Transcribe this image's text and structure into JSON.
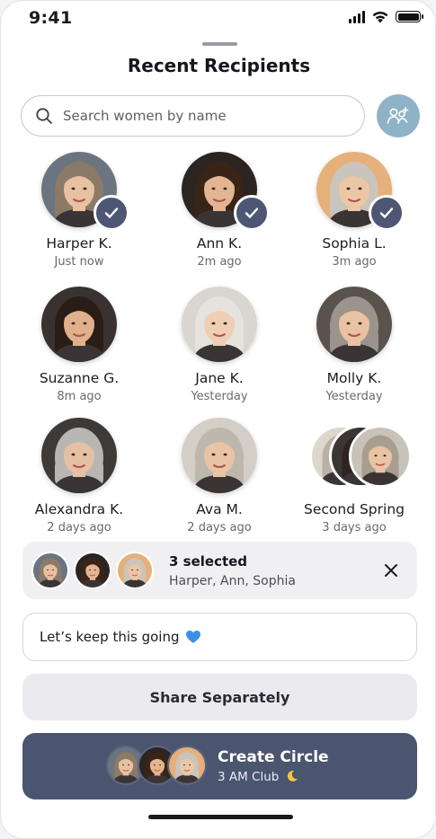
{
  "status_bar": {
    "time": "9:41"
  },
  "sheet": {
    "title": "Recent Recipients"
  },
  "search": {
    "placeholder": "Search women by name",
    "value": ""
  },
  "recipients": [
    {
      "name": "Harper K.",
      "time": "Just now",
      "selected": true,
      "hair": "#8c7a68",
      "skin": "#e7c1a1",
      "bg": "#6b7580"
    },
    {
      "name": "Ann K.",
      "time": "2m ago",
      "selected": true,
      "hair": "#3a2418",
      "skin": "#e3b592",
      "bg": "#2c2420"
    },
    {
      "name": "Sophia L.",
      "time": "3m ago",
      "selected": true,
      "hair": "#c9c4bc",
      "skin": "#ecc7a6",
      "bg": "#e6b07a"
    },
    {
      "name": "Suzanne G.",
      "time": "8m ago",
      "selected": false,
      "hair": "#2a1c16",
      "skin": "#e0b08c",
      "bg": "#3a3230"
    },
    {
      "name": "Jane K.",
      "time": "Yesterday",
      "selected": false,
      "hair": "#e6e3de",
      "skin": "#efcfb4",
      "bg": "#d9d6d0"
    },
    {
      "name": "Molly K.",
      "time": "Yesterday",
      "selected": false,
      "hair": "#9a948c",
      "skin": "#e8c2a2",
      "bg": "#5a534c"
    },
    {
      "name": "Alexandra K.",
      "time": "2 days ago",
      "selected": false,
      "hair": "#b8b6b2",
      "skin": "#e5c0a2",
      "bg": "#3d3a38"
    },
    {
      "name": "Ava M.",
      "time": "2 days ago",
      "selected": false,
      "hair": "#bdb7ae",
      "skin": "#e9c4a4",
      "bg": "#d4cfc6"
    },
    {
      "name": "Second Spring",
      "time": "3 days ago",
      "selected": false,
      "group": true,
      "hair": "#a89e90",
      "skin": "#e8c4a4",
      "bg": "#c8c2b8"
    }
  ],
  "selection": {
    "title": "3 selected",
    "names": "Harper, Ann, Sophia"
  },
  "message": {
    "text": "Let’s keep this going",
    "emoji": "blue-heart"
  },
  "share_button": {
    "label": "Share Separately"
  },
  "create_button": {
    "title": "Create Circle",
    "subtitle": "3 AM Club",
    "emoji": "crescent-moon"
  },
  "colors": {
    "accent": "#4b556f",
    "group_button": "#8fb3c6",
    "check": "#4d5672"
  }
}
